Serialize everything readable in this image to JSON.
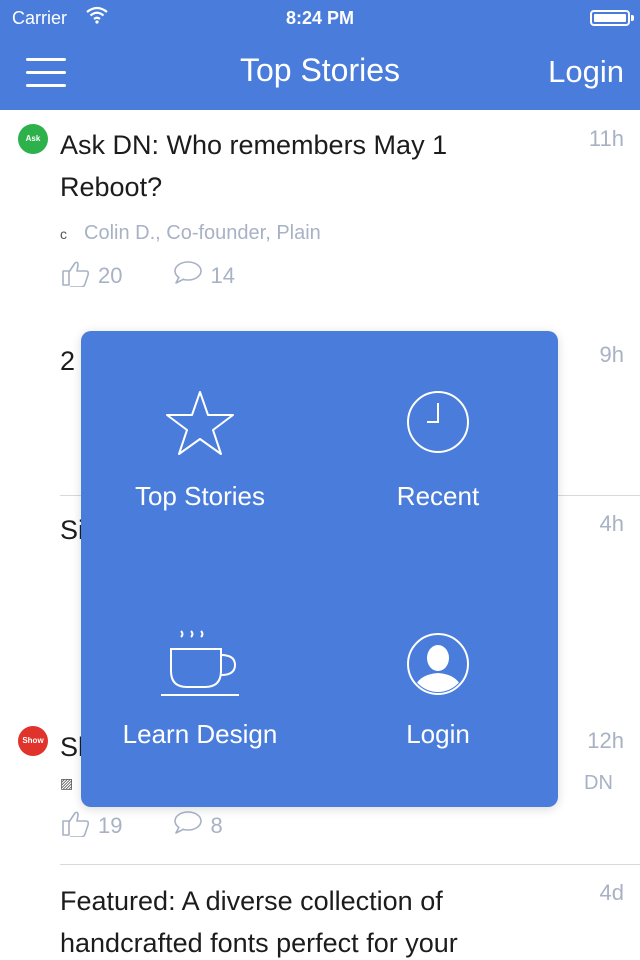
{
  "status_bar": {
    "carrier": "Carrier",
    "time": "8:24 PM"
  },
  "nav": {
    "title": "Top Stories",
    "login_label": "Login"
  },
  "stories": [
    {
      "badge": "Ask",
      "badge_color": "#2db14b",
      "title": "Ask DN: Who remembers May 1 Reboot?",
      "time": "11h",
      "author": "Colin D., Co-founder, Plain",
      "upvotes": "20",
      "comments": "14"
    },
    {
      "title_partial": "2",
      "time": "9h"
    },
    {
      "title_partial": "Si",
      "time": "4h"
    },
    {
      "badge": "Show",
      "badge_color": "#e0332b",
      "title_partial": "Sl",
      "time": "12h",
      "author_partial": "DN",
      "upvotes_partial": "19",
      "comments_partial": "8"
    },
    {
      "title": "Featured: A diverse collection of handcrafted fonts perfect for your",
      "time": "4d"
    }
  ],
  "menu": {
    "items": [
      {
        "label": "Top Stories",
        "icon": "star-icon"
      },
      {
        "label": "Recent",
        "icon": "clock-icon"
      },
      {
        "label": "Learn Design",
        "icon": "coffee-cup-icon"
      },
      {
        "label": "Login",
        "icon": "user-avatar-icon"
      }
    ]
  },
  "colors": {
    "brand": "#4a7ddb",
    "muted_text": "#a8b2c4",
    "ask_badge": "#2db14b",
    "show_badge": "#e0332b"
  }
}
